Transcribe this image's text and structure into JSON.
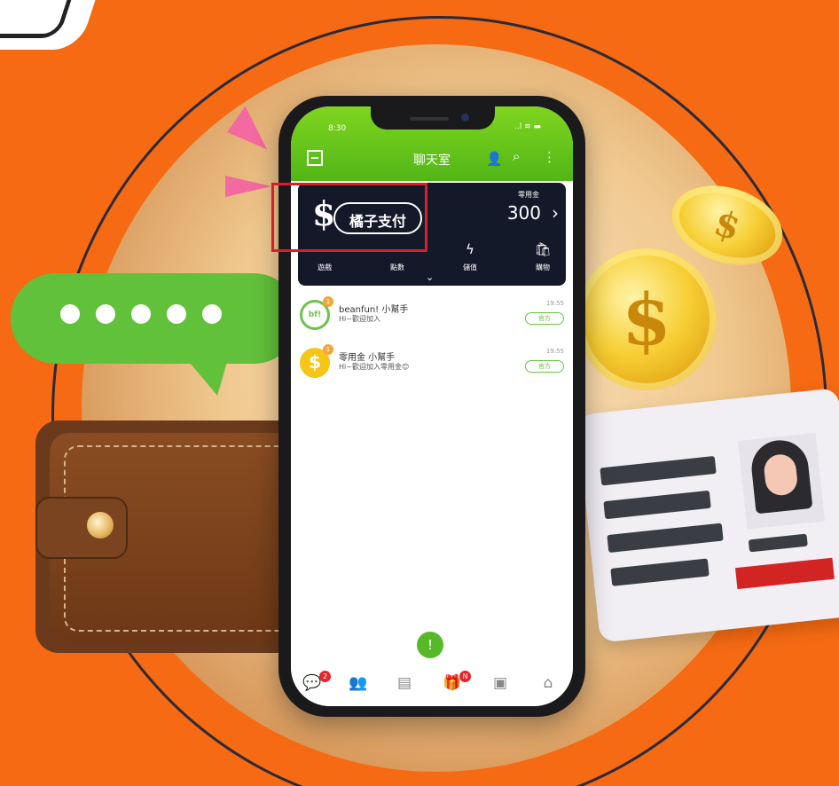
{
  "phone": {
    "status_time": "8:30",
    "status_icons": "..l ≋ ▬",
    "title": "聊天室",
    "icons": [
      "scan-icon",
      "person-icon",
      "search-icon",
      "more-icon"
    ]
  },
  "payment": {
    "logo": "$",
    "label": "橘子支付",
    "balance_label": "零用金",
    "balance_value": "300",
    "balance_chevron": "›",
    "items": [
      {
        "label": "遊戲",
        "icon": ""
      },
      {
        "label": "點數",
        "icon": ""
      },
      {
        "label": "儲值",
        "icon": "ϟ"
      },
      {
        "label": "購物",
        "icon": "🛍"
      }
    ],
    "expand": "⌄"
  },
  "chats": [
    {
      "name": "beanfun! 小幫手",
      "message": "Hi~歡迎加入",
      "time": "19:55",
      "tag": "官方",
      "badge": "1",
      "avatar_text": "bf!",
      "avatar_color": "#6cc24a"
    },
    {
      "name": "零用金 小幫手",
      "message": "Hi~歡迎加入零用金😊",
      "time": "19:55",
      "tag": "官方",
      "badge": "1",
      "avatar_text": "$",
      "avatar_color": "#f5c518"
    }
  ],
  "fab_icon": "!",
  "tabs": [
    {
      "icon": "💬",
      "badge": "2"
    },
    {
      "icon": "👥",
      "badge": ""
    },
    {
      "icon": "▤",
      "badge": ""
    },
    {
      "icon": "🎁",
      "badge": "N"
    },
    {
      "icon": "▣",
      "badge": ""
    },
    {
      "icon": "⌂",
      "badge": ""
    }
  ],
  "coin_symbol": "$",
  "colors": {
    "background": "#f56a12",
    "brand_green": "#58b928",
    "highlight_red": "#d61f2a",
    "panel_dark": "#14192a"
  }
}
